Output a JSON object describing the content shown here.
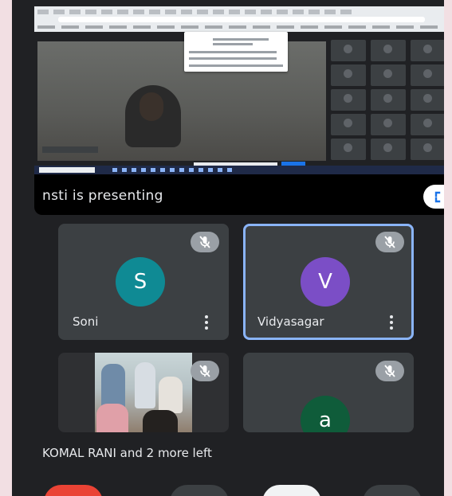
{
  "presentation": {
    "banner_text": "nsti is presenting"
  },
  "participants": [
    {
      "name": "Soni",
      "initial": "S",
      "color": "#0f8a94",
      "muted": true
    },
    {
      "name": "Vidyasagar",
      "initial": "V",
      "color": "#7b4ec6",
      "muted": true,
      "active_speaker": true
    },
    {
      "name": "",
      "initial": "",
      "muted": true,
      "has_video": true
    },
    {
      "name": "",
      "initial": "a",
      "color": "#0f5c3a",
      "muted": true
    }
  ],
  "notification": {
    "text": "KOMAL RANI and 2 more left"
  },
  "controls": {
    "icons": [
      "end-call-icon",
      "microphone-icon",
      "camera-icon",
      "more-options-icon"
    ]
  }
}
